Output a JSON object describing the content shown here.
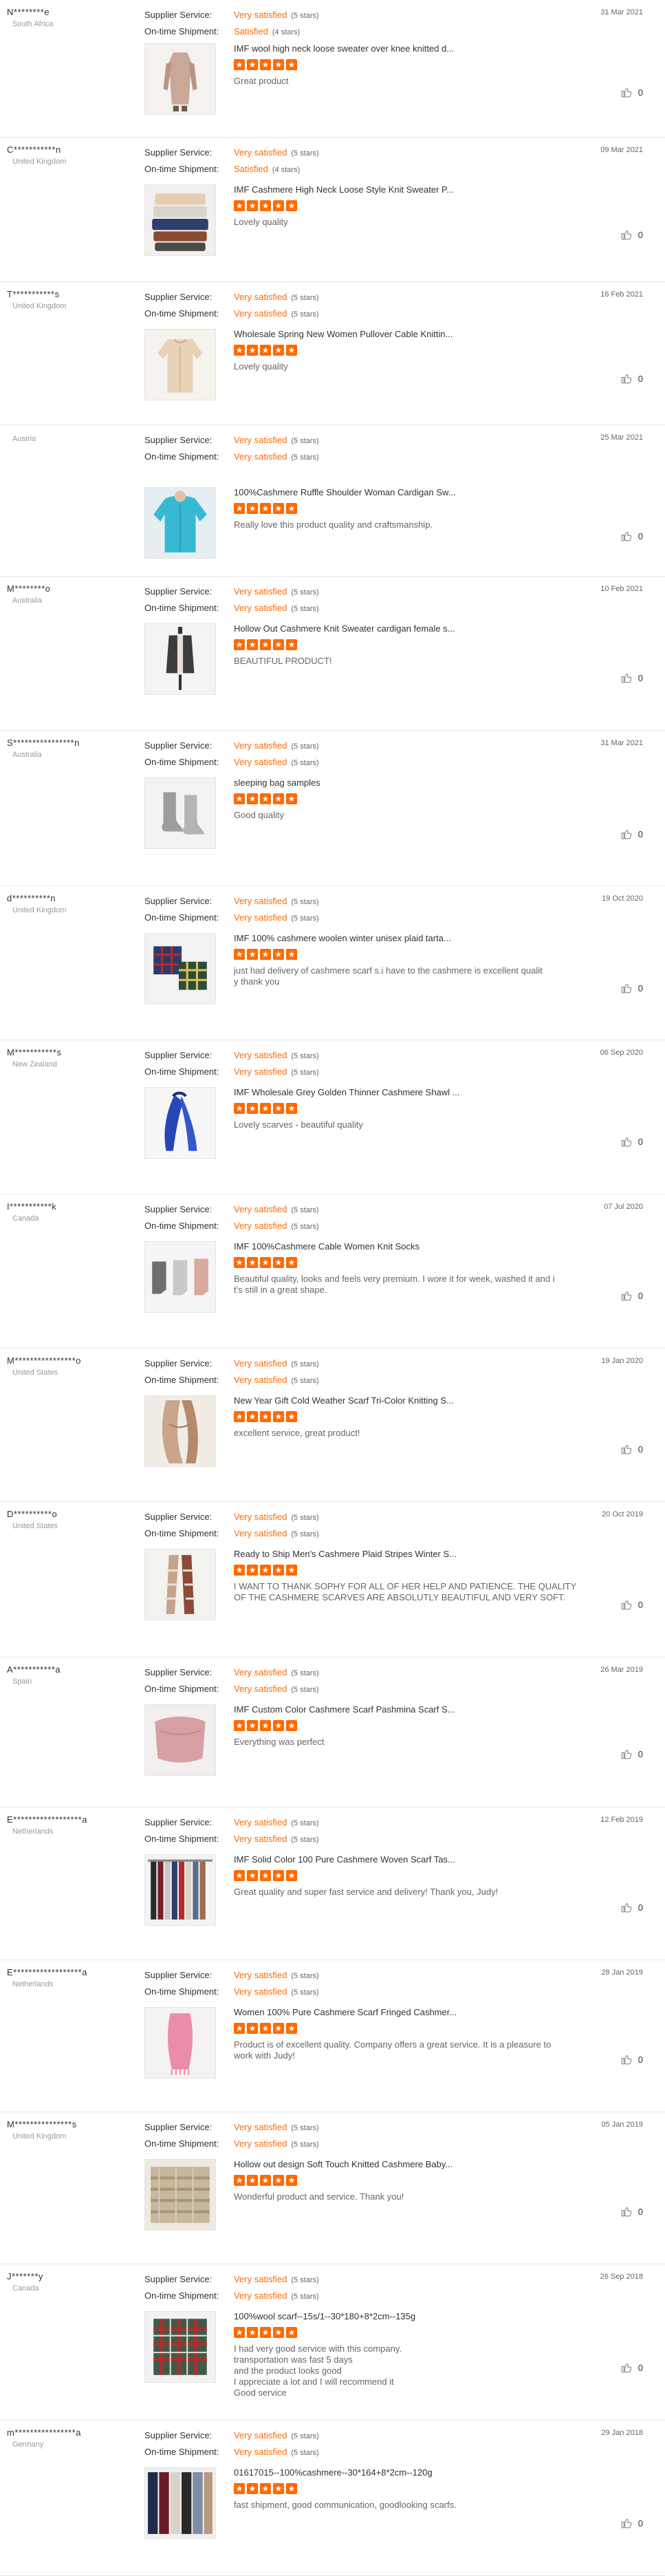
{
  "labels": {
    "supplier_service": "Supplier Service:",
    "ontime_shipment": "On-time Shipment:"
  },
  "reviews": [
    {
      "buyer": "N********e",
      "country": "South Africa",
      "date": "31 Mar 2021",
      "supplier_value": "Very satisfied",
      "supplier_stars": "(5 stars)",
      "shipment_value": "Satisfied",
      "shipment_stars": "(4 stars)",
      "product": "IMF wool high neck loose sweater over knee knitted d...",
      "rating": 5,
      "comment": "Great product",
      "likes": "0",
      "thumb": "dress-beige"
    },
    {
      "buyer": "C***********n",
      "country": "United Kingdom",
      "date": "09 Mar 2021",
      "supplier_value": "Very satisfied",
      "supplier_stars": "(5 stars)",
      "shipment_value": "Satisfied",
      "shipment_stars": "(4 stars)",
      "product": "IMF Cashmere High Neck Loose Style Knit Sweater P...",
      "rating": 5,
      "comment": "Lovely quality",
      "likes": "0",
      "thumb": "folded-sweaters"
    },
    {
      "buyer": "T***********s",
      "country": "United Kingdom",
      "date": "16 Feb 2021",
      "supplier_value": "Very satisfied",
      "supplier_stars": "(5 stars)",
      "shipment_value": "Very satisfied",
      "shipment_stars": "(5 stars)",
      "product": "Wholesale Spring New Women Pullover Cable Knittin...",
      "rating": 5,
      "comment": "Lovely quality",
      "likes": "0",
      "thumb": "cream-pullover"
    },
    {
      "buyer": "",
      "country": "Austria",
      "date": "25 Mar 2021",
      "supplier_value": "Very satisfied",
      "supplier_stars": "(5 stars)",
      "shipment_value": "Very satisfied",
      "shipment_stars": "(5 stars)",
      "product": "100%Cashmere Ruffle Shoulder Woman Cardigan Sw...",
      "rating": 5,
      "comment": "Really love this product quality and craftsmanship.",
      "likes": "0",
      "thumb": "turquoise-cardigan"
    },
    {
      "buyer": "M********o",
      "country": "Australia",
      "date": "10 Feb 2021",
      "supplier_value": "Very satisfied",
      "supplier_stars": "(5 stars)",
      "shipment_value": "Very satisfied",
      "shipment_stars": "(5 stars)",
      "product": "Hollow Out Cashmere Knit Sweater cardigan female s...",
      "rating": 5,
      "comment": "BEAUTIFUL PRODUCT!",
      "likes": "0",
      "thumb": "cardigan-mannequin"
    },
    {
      "buyer": "S****************n",
      "country": "Australia",
      "date": "31 Mar 2021",
      "supplier_value": "Very satisfied",
      "supplier_stars": "(5 stars)",
      "shipment_value": "Very satisfied",
      "shipment_stars": "(5 stars)",
      "product": "sleeping bag samples",
      "rating": 5,
      "comment": "Good quality",
      "likes": "0",
      "thumb": "grey-socks"
    },
    {
      "buyer": "d**********n",
      "country": "United Kingdom",
      "date": "19 Oct 2020",
      "supplier_value": "Very satisfied",
      "supplier_stars": "(5 stars)",
      "shipment_value": "Very satisfied",
      "shipment_stars": "(5 stars)",
      "product": "IMF 100% cashmere woolen winter unisex plaid tarta...",
      "rating": 5,
      "comment": "just had delivery  of cashmere  scarf s.i have to the cashmere  is excellent  qualit\ny  thank you",
      "likes": "0",
      "thumb": "plaid-scarves"
    },
    {
      "buyer": "M***********s",
      "country": "New Zealand",
      "date": "06 Sep 2020",
      "supplier_value": "Very satisfied",
      "supplier_stars": "(5 stars)",
      "shipment_value": "Very satisfied",
      "shipment_stars": "(5 stars)",
      "product": "IMF Wholesale Grey Golden Thinner Cashmere Shawl ...",
      "rating": 5,
      "comment": "Lovely scarves - beautiful quality",
      "likes": "0",
      "thumb": "blue-shawl"
    },
    {
      "buyer": "I***********k",
      "country": "Canada",
      "date": "07 Jul 2020",
      "supplier_value": "Very satisfied",
      "supplier_stars": "(5 stars)",
      "shipment_value": "Very satisfied",
      "shipment_stars": "(5 stars)",
      "product": "IMF 100%Cashmere Cable Women Knit Socks",
      "rating": 5,
      "comment": "Beautiful quality, looks and feels very premium. I wore it for week, washed it and i\nt's still in a great shape.",
      "likes": "0",
      "thumb": "knit-socks"
    },
    {
      "buyer": "M****************o",
      "country": "United States",
      "date": "19 Jan 2020",
      "supplier_value": "Very satisfied",
      "supplier_stars": "(5 stars)",
      "shipment_value": "Very satisfied",
      "shipment_stars": "(5 stars)",
      "product": "New Year Gift Cold Weather Scarf Tri-Color Knitting S...",
      "rating": 5,
      "comment": "excellent service, great product!",
      "likes": "0",
      "thumb": "tan-scarf"
    },
    {
      "buyer": "D**********o",
      "country": "United States",
      "date": "20 Oct 2019",
      "supplier_value": "Very satisfied",
      "supplier_stars": "(5 stars)",
      "shipment_value": "Very satisfied",
      "shipment_stars": "(5 stars)",
      "product": "Ready to Ship Men's Cashmere Plaid Stripes Winter S...",
      "rating": 5,
      "comment": "I WANT TO THANK SOPHY FOR ALL OF HER HELP AND PATIENCE. THE QUALITY\n OF THE CASHMERE SCARVES ARE ABSOLUTLY BEAUTIFUL AND VERY SOFT.",
      "likes": "0",
      "thumb": "plaid-stripes"
    },
    {
      "buyer": "A***********a",
      "country": "Spain",
      "date": "26 Mar 2019",
      "supplier_value": "Very satisfied",
      "supplier_stars": "(5 stars)",
      "shipment_value": "Very satisfied",
      "shipment_stars": "(5 stars)",
      "product": "IMF Custom Color Cashmere Scarf Pashmina Scarf S...",
      "rating": 5,
      "comment": "Everything was perfect",
      "likes": "0",
      "thumb": "pink-pashmina"
    },
    {
      "buyer": "E******************a",
      "country": "Netherlands",
      "date": "12 Feb 2019",
      "supplier_value": "Very satisfied",
      "supplier_stars": "(5 stars)",
      "shipment_value": "Very satisfied",
      "shipment_stars": "(5 stars)",
      "product": "IMF Solid Color 100 Pure Cashmere Woven Scarf Tas...",
      "rating": 5,
      "comment": "Great quality and super fast service and delivery! Thank you, Judy!",
      "likes": "0",
      "thumb": "hanging-scarves"
    },
    {
      "buyer": "E******************a",
      "country": "Netherlands",
      "date": "28 Jan 2019",
      "supplier_value": "Very satisfied",
      "supplier_stars": "(5 stars)",
      "shipment_value": "Very satisfied",
      "shipment_stars": "(5 stars)",
      "product": "Women 100% Pure Cashmere Scarf Fringed Cashmer...",
      "rating": 5,
      "comment": "Product is of excellent quality. Company offers a great service. It is a pleasure to\nwork with Judy!",
      "likes": "0",
      "thumb": "pink-fringed"
    },
    {
      "buyer": "M***************s",
      "country": "United Kingdom",
      "date": "05 Jan 2019",
      "supplier_value": "Very satisfied",
      "supplier_stars": "(5 stars)",
      "shipment_value": "Very satisfied",
      "shipment_stars": "(5 stars)",
      "product": "Hollow out design Soft Touch Knitted Cashmere Baby...",
      "rating": 5,
      "comment": "Wonderful product and service. Thank you!",
      "likes": "0",
      "thumb": "baby-blanket"
    },
    {
      "buyer": "J*******y",
      "country": "Canada",
      "date": "26 Sep 2018",
      "supplier_value": "Very satisfied",
      "supplier_stars": "(5 stars)",
      "shipment_value": "Very satisfied",
      "shipment_stars": "(5 stars)",
      "product": "100%wool scarf--15s/1--30*180+8*2cm--135g",
      "rating": 5,
      "comment": "I had very good service with this company.\ntransportation was fast 5 days\nand the product looks good\nI appreciate a lot and I will recommend it\nGood service",
      "likes": "0",
      "thumb": "tartan-scarf"
    },
    {
      "buyer": "m****************a",
      "country": "Germany",
      "date": "29 Jan 2018",
      "supplier_value": "Very satisfied",
      "supplier_stars": "(5 stars)",
      "shipment_value": "Very satisfied",
      "shipment_stars": "(5 stars)",
      "product": "01617015--100%cashmere--30*164+8*2cm--120g",
      "rating": 5,
      "comment": "fast shipment, good communication, goodlooking scarfs.",
      "likes": "0",
      "thumb": "scarf-grid"
    }
  ]
}
